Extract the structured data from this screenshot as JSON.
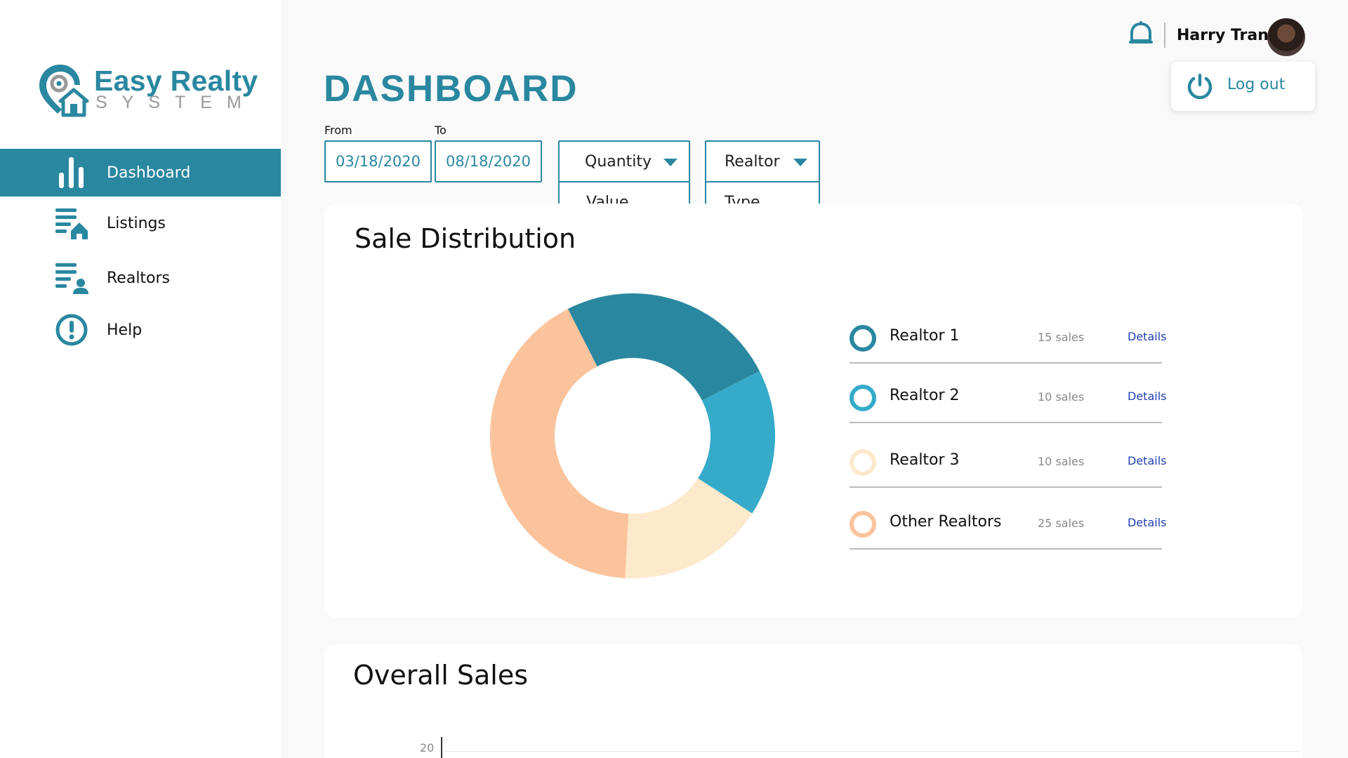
{
  "brand": {
    "name": "Easy Realty",
    "subtitle": "SYSTEM",
    "accent": "#2a87a0"
  },
  "sidebar": {
    "items": [
      {
        "label": "Dashboard",
        "icon": "bar-chart-icon",
        "active": true
      },
      {
        "label": "Listings",
        "icon": "listings-icon",
        "active": false
      },
      {
        "label": "Realtors",
        "icon": "realtors-icon",
        "active": false
      },
      {
        "label": "Help",
        "icon": "alert-circle-icon",
        "active": false
      }
    ]
  },
  "header": {
    "title": "DASHBOARD",
    "user_name": "Harry Tran",
    "logout_label": "Log out"
  },
  "filters": {
    "from_label": "From",
    "to_label": "To",
    "from_value": "03/18/2020",
    "to_value": "08/18/2020",
    "metric_selected": "Quantity",
    "metric_option": "Value",
    "group_selected": "Realtor",
    "group_option": "Type"
  },
  "sale_distribution": {
    "title": "Sale Distribution",
    "details_label": "Details",
    "legend": [
      {
        "name": "Realtor 1",
        "sales": "15 sales",
        "color": "#2a87a0"
      },
      {
        "name": "Realtor 2",
        "sales": "10 sales",
        "color": "#35abc9"
      },
      {
        "name": "Realtor 3",
        "sales": "10 sales",
        "color": "#fde9cb"
      },
      {
        "name": "Other Realtors",
        "sales": "25 sales",
        "color": "#fbc39c"
      }
    ]
  },
  "chart_data": {
    "type": "pie",
    "categories": [
      "Realtor 1",
      "Realtor 2",
      "Realtor 3",
      "Other Realtors"
    ],
    "values": [
      15,
      10,
      10,
      25
    ],
    "colors": [
      "#2a87a0",
      "#35abc9",
      "#fde9cb",
      "#fbc39c"
    ],
    "title": "Sale Distribution",
    "donut": true
  },
  "overall_sales": {
    "title": "Overall Sales",
    "y_tick": "20"
  }
}
